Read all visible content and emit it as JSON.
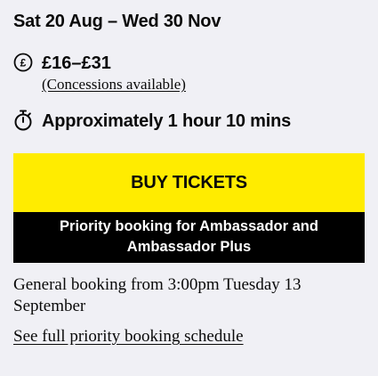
{
  "event": {
    "dates": "Sat 20 Aug – Wed 30 Nov",
    "price": "£16–£31",
    "concessions_link": "(Concessions available)",
    "duration": "Approximately 1 hour 10 mins"
  },
  "tickets": {
    "buy_label": "BUY TICKETS",
    "priority_text": "Priority booking for Ambassador and Ambassador Plus"
  },
  "booking": {
    "general_text": "General booking from 3:00pm Tuesday 13 September",
    "schedule_link": "See full priority booking schedule"
  },
  "icons": {
    "price": "pound-icon",
    "duration": "stopwatch-icon"
  },
  "colors": {
    "background": "#f0f0f5",
    "accent": "#ffec00",
    "banner": "#000000",
    "text": "#0a0a0a"
  }
}
